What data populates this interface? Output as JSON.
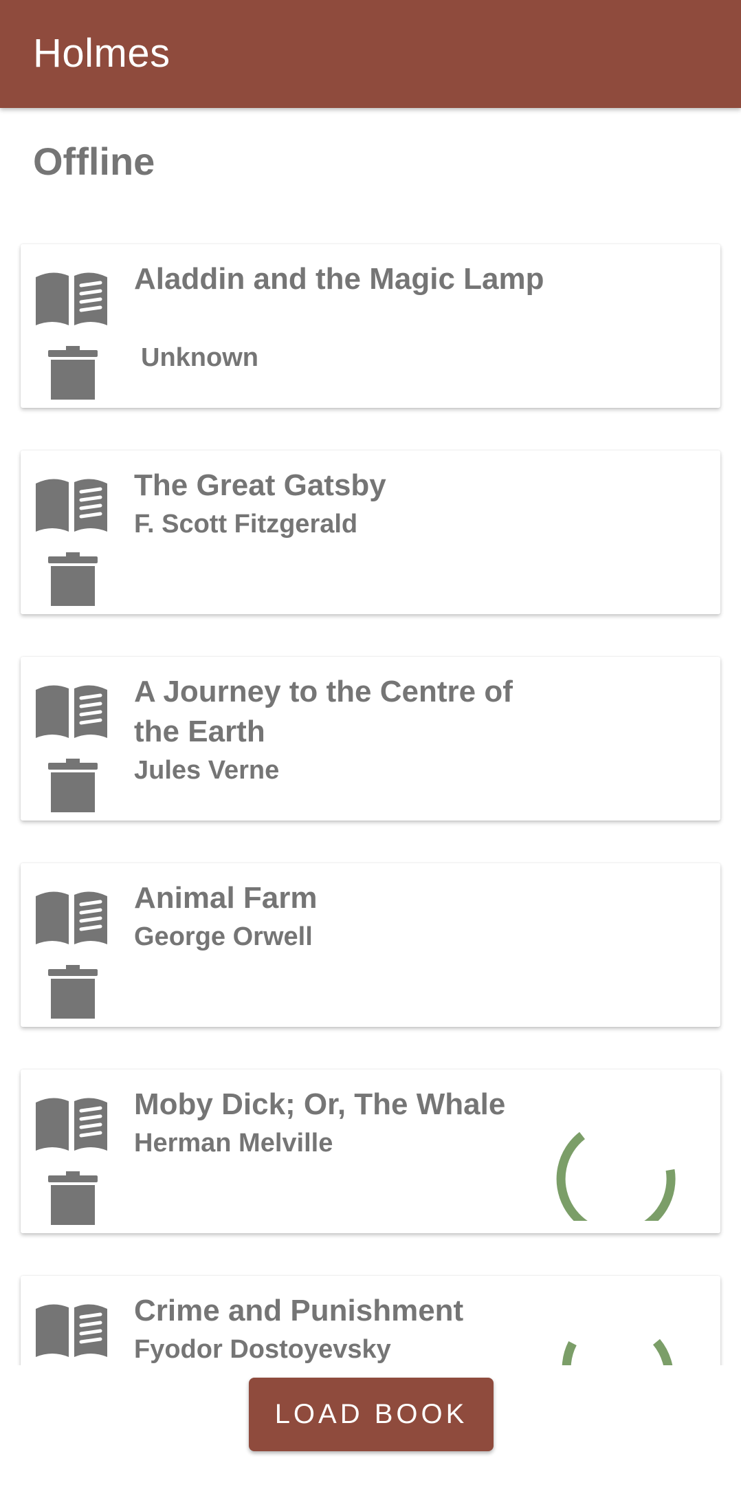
{
  "app": {
    "title": "Holmes"
  },
  "section": {
    "title": "Offline"
  },
  "books": [
    {
      "title": "Aladdin and the Magic Lamp",
      "author": "Unknown",
      "loading": false
    },
    {
      "title": "The Great Gatsby",
      "author": "F. Scott Fitzgerald",
      "loading": false
    },
    {
      "title": "A Journey to the Centre of the Earth",
      "author": "Jules Verne",
      "loading": false
    },
    {
      "title": "Animal Farm",
      "author": "George Orwell",
      "loading": false
    },
    {
      "title": "Moby Dick; Or, The Whale",
      "author": "Herman Melville",
      "loading": true
    },
    {
      "title": "Crime and Punishment",
      "author": "Fyodor Dostoyevsky",
      "loading": true
    }
  ],
  "actions": {
    "load_book_label": "LOAD BOOK"
  },
  "icons": {
    "book": "open-book-icon",
    "delete": "trash-icon",
    "progress": "progress-spinner-icon"
  },
  "colors": {
    "primary": "#8f4b3d",
    "text": "#757575",
    "spinner": "#7b9e68"
  }
}
